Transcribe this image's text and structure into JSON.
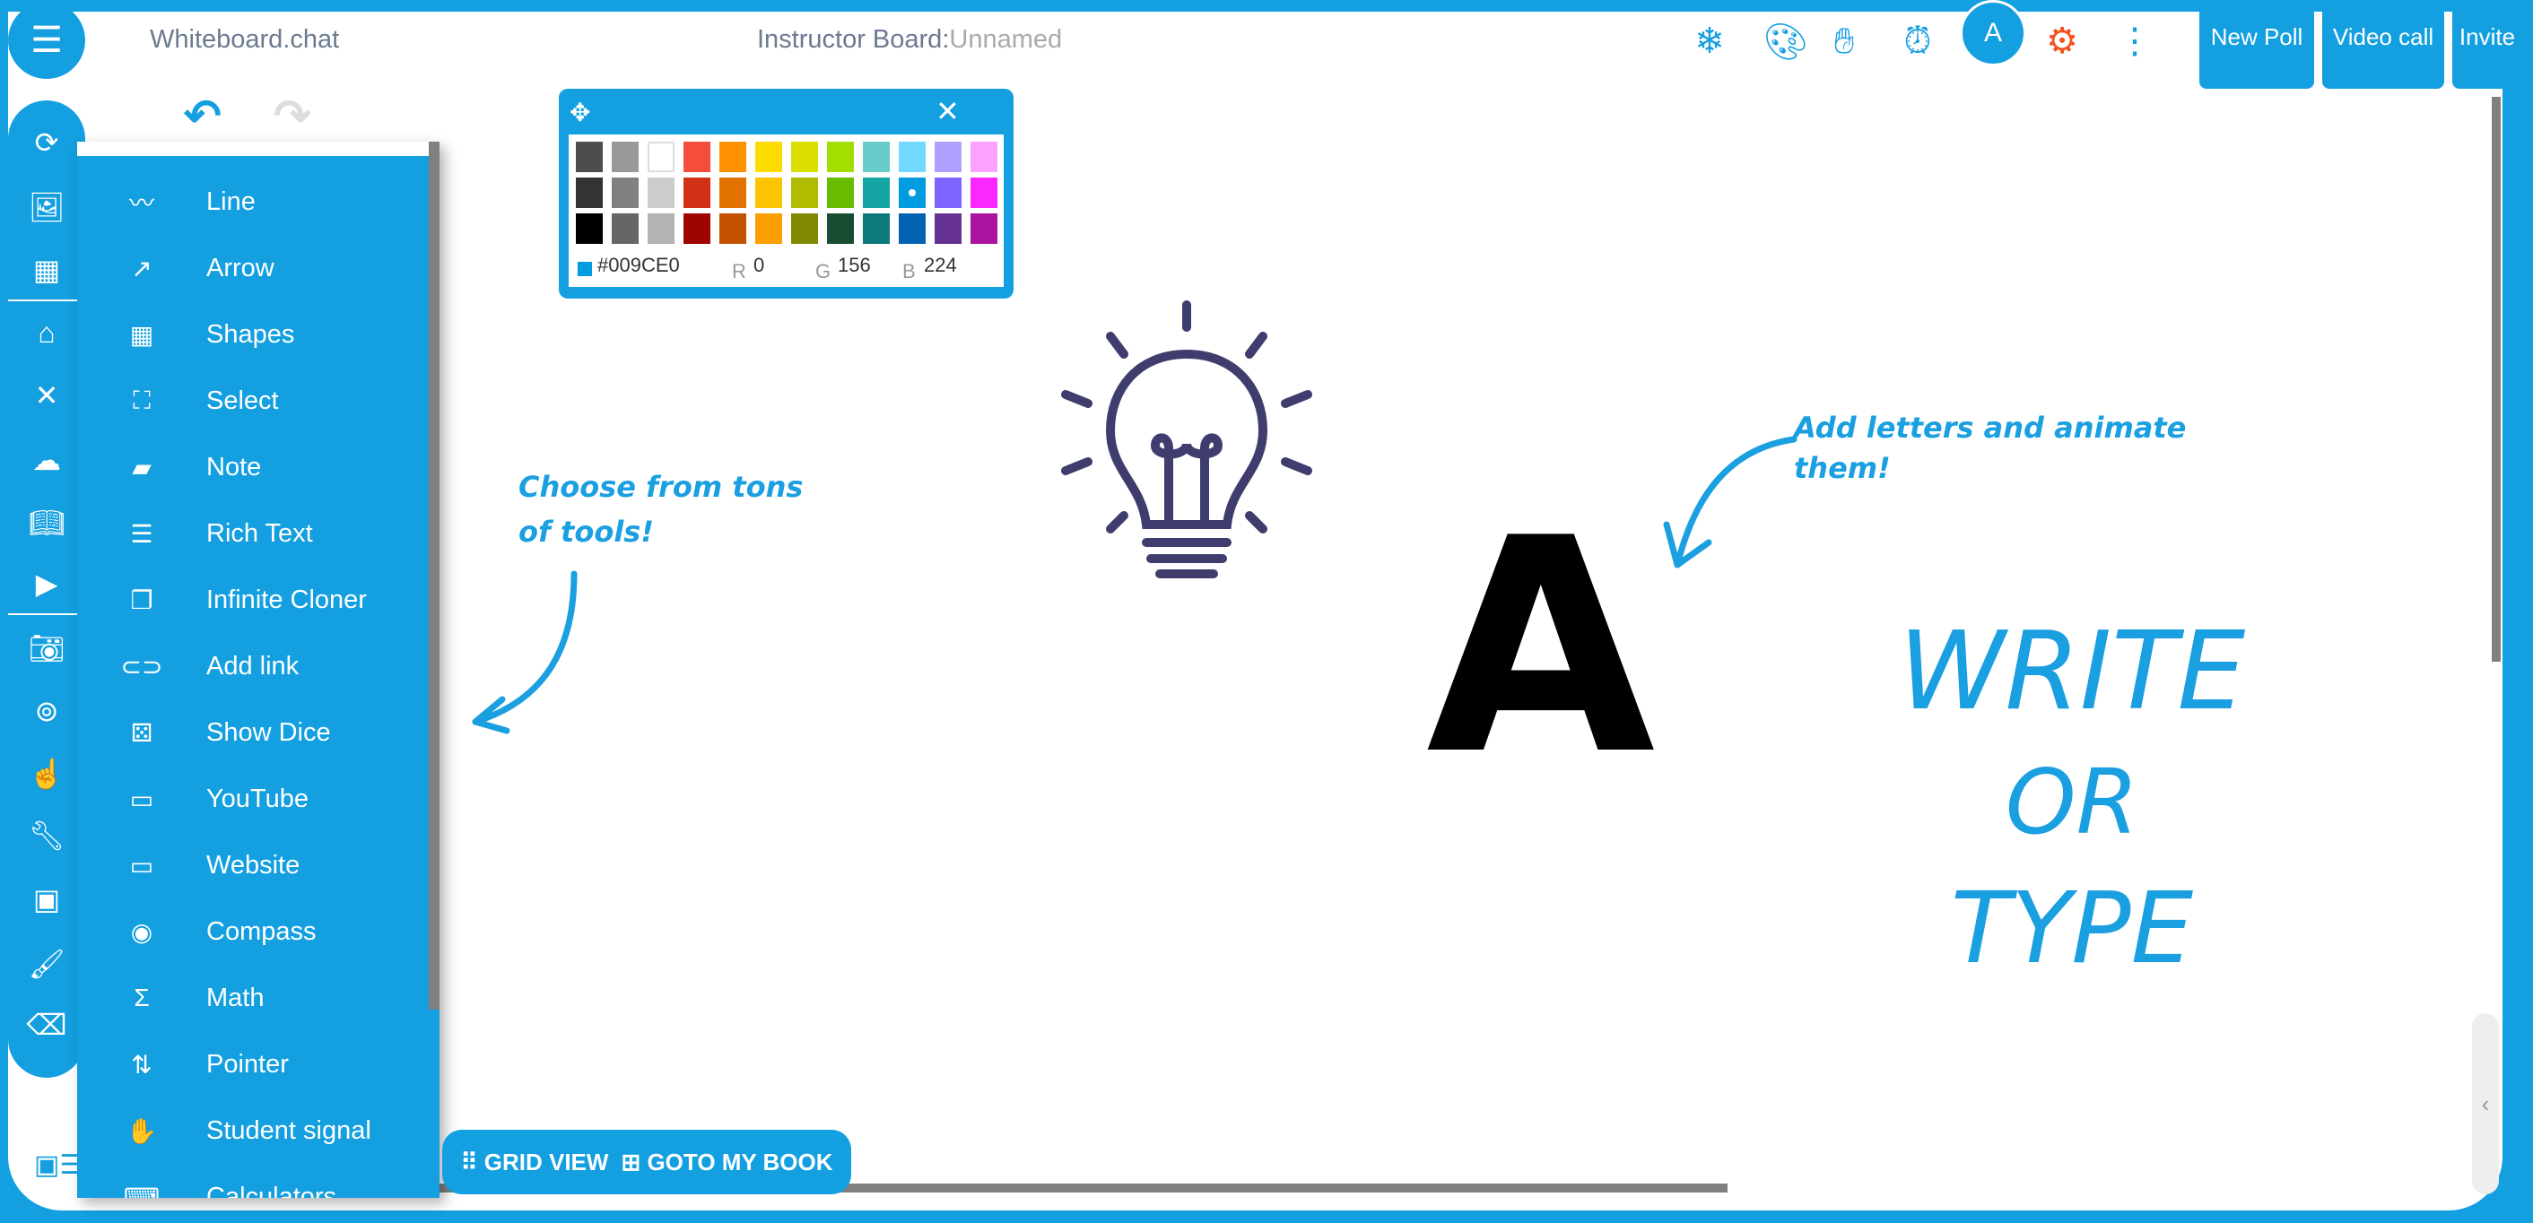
{
  "header": {
    "app_name": "Whiteboard.chat",
    "board_label": "Instructor Board:",
    "board_name": "Unnamed",
    "avatar_letter": "A",
    "buttons": [
      "New Poll",
      "Video call",
      "Invite"
    ]
  },
  "tools_menu": [
    {
      "label": "Line",
      "icon": "line-icon",
      "glyph": "〰"
    },
    {
      "label": "Arrow",
      "icon": "arrow-icon",
      "glyph": "↗"
    },
    {
      "label": "Shapes",
      "icon": "shapes-icon",
      "glyph": "▦"
    },
    {
      "label": "Select",
      "icon": "select-icon",
      "glyph": "⛶"
    },
    {
      "label": "Note",
      "icon": "note-icon",
      "glyph": "▰"
    },
    {
      "label": "Rich Text",
      "icon": "text-icon",
      "glyph": "☰"
    },
    {
      "label": "Infinite Cloner",
      "icon": "copy-icon",
      "glyph": "❐"
    },
    {
      "label": "Add link",
      "icon": "link-icon",
      "glyph": "⊂⊃"
    },
    {
      "label": "Show Dice",
      "icon": "dice-icon",
      "glyph": "⚄"
    },
    {
      "label": "YouTube",
      "icon": "video-icon",
      "glyph": "▭"
    },
    {
      "label": "Website",
      "icon": "website-icon",
      "glyph": "▭"
    },
    {
      "label": "Compass",
      "icon": "compass-icon",
      "glyph": "◉"
    },
    {
      "label": "Math",
      "icon": "sigma-icon",
      "glyph": "Σ"
    },
    {
      "label": "Pointer",
      "icon": "pointer-icon",
      "glyph": "⇅"
    },
    {
      "label": "Student signal",
      "icon": "hand-icon",
      "glyph": "✋"
    },
    {
      "label": "Calculators",
      "icon": "keyboard-icon",
      "glyph": "⌨"
    }
  ],
  "color_picker": {
    "hex": "#009CE0",
    "r_label": "R",
    "r": "0",
    "g_label": "G",
    "g": "156",
    "b_label": "B",
    "b": "224",
    "selected": "#009ce0",
    "swatches": [
      "#4d4d4d",
      "#999999",
      "#ffffff",
      "#f44e3b",
      "#fe9200",
      "#fcdc00",
      "#dbdf00",
      "#a4dd00",
      "#68ccca",
      "#73d8ff",
      "#aea1ff",
      "#fda1ff",
      "#333333",
      "#808080",
      "#cccccc",
      "#d33115",
      "#e27300",
      "#fcc400",
      "#b0bc00",
      "#68bc00",
      "#16a5a5",
      "#009ce0",
      "#7b64ff",
      "#fa28ff",
      "#000000",
      "#666666",
      "#b3b3b3",
      "#9f0500",
      "#c45100",
      "#fb9e00",
      "#808900",
      "#194d33",
      "#0c797d",
      "#0062b1",
      "#653294",
      "#ab149e"
    ]
  },
  "canvas": {
    "note_tools": "Choose from tons of tools!",
    "note_letters": "Add letters and animate them!",
    "big_letter": "A",
    "write_lines": [
      "WRITE",
      "OR",
      "TYPE"
    ]
  },
  "bottom": {
    "grid_view": "GRID VIEW",
    "goto_book": "GOTO MY BOOK"
  },
  "colors": {
    "brand": "#139fe0",
    "gear": "#f4511e",
    "lightbulb": "#3f3d6e"
  }
}
